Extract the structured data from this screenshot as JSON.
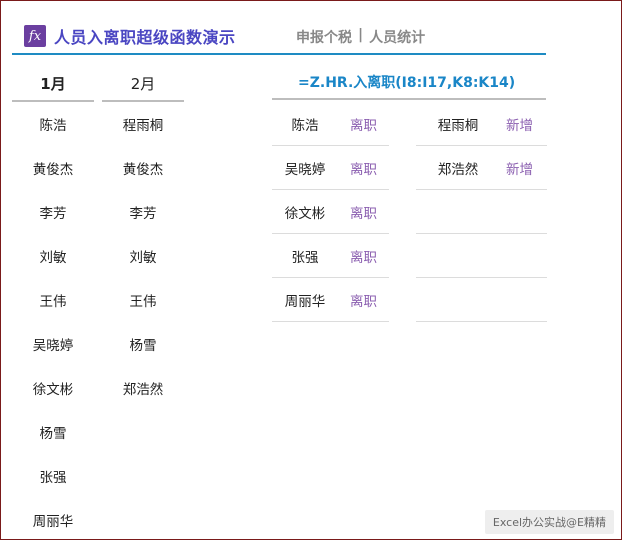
{
  "header": {
    "icon": "fx-icon",
    "title": "人员入离职超级函数演示",
    "nav": [
      "申报个税",
      "人员统计"
    ],
    "nav_separator": "|"
  },
  "tabs": [
    {
      "label": "1月",
      "active": true
    },
    {
      "label": "2月",
      "active": false
    }
  ],
  "formula": "=Z.HR.入离职(I8:I17,K8:K14)",
  "january_names": [
    "陈浩",
    "黄俊杰",
    "李芳",
    "刘敏",
    "王伟",
    "吴晓婷",
    "徐文彬",
    "杨雪",
    "张强",
    "周丽华"
  ],
  "february_names": [
    "程雨桐",
    "黄俊杰",
    "李芳",
    "刘敏",
    "王伟",
    "杨雪",
    "郑浩然"
  ],
  "result_left": [
    {
      "name": "陈浩",
      "status": "离职"
    },
    {
      "name": "吴晓婷",
      "status": "离职"
    },
    {
      "name": "徐文彬",
      "status": "离职"
    },
    {
      "name": "张强",
      "status": "离职"
    },
    {
      "name": "周丽华",
      "status": "离职"
    }
  ],
  "result_right": [
    {
      "name": "程雨桐",
      "status": "新增"
    },
    {
      "name": "郑浩然",
      "status": "新增"
    },
    {
      "name": "",
      "status": ""
    },
    {
      "name": "",
      "status": ""
    },
    {
      "name": "",
      "status": ""
    }
  ],
  "watermark": "Excel办公实战@E精精",
  "colors": {
    "accent": "#1e8bc3",
    "title": "#4a46c2",
    "status": "#8b5fb0",
    "icon_bg": "#6b3fa0"
  }
}
